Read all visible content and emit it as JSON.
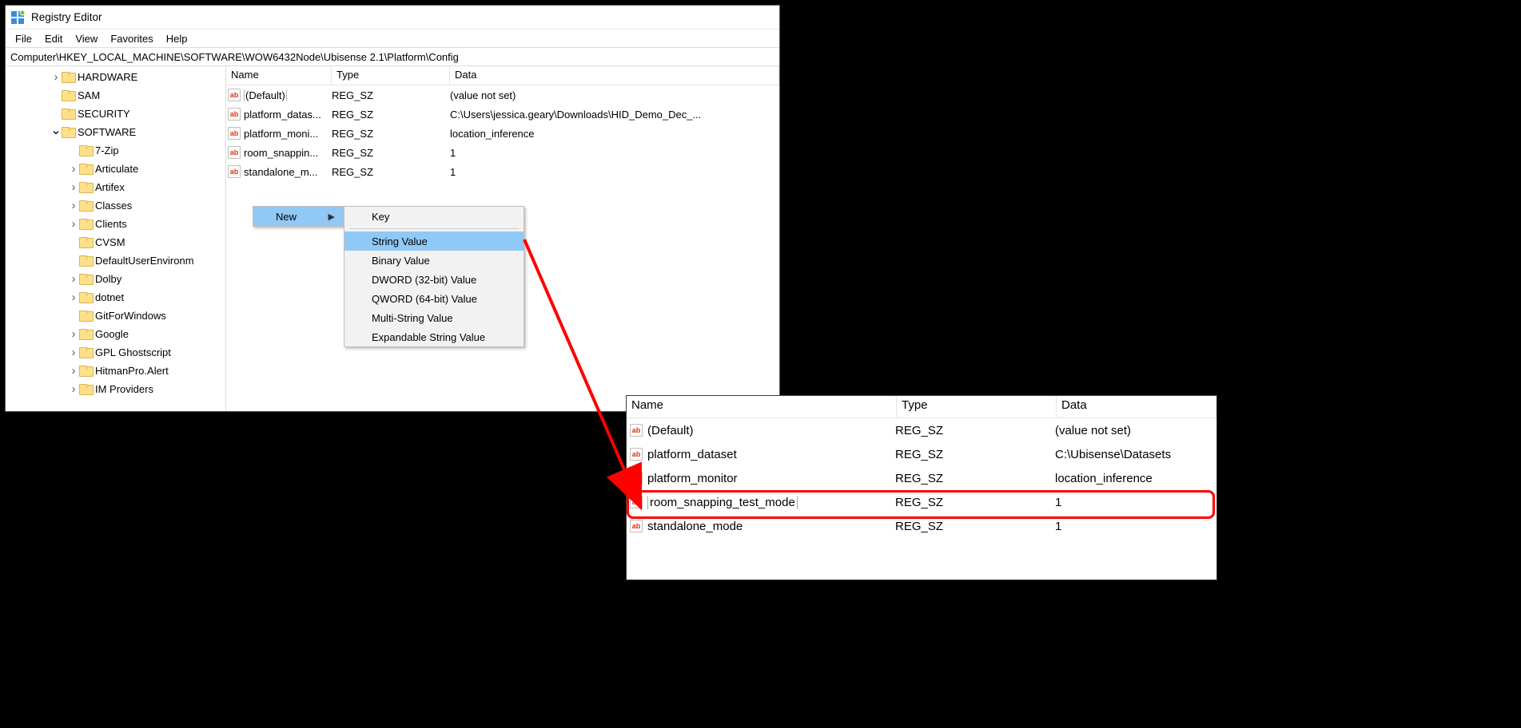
{
  "window": {
    "title": "Registry Editor",
    "menu": [
      "File",
      "Edit",
      "View",
      "Favorites",
      "Help"
    ],
    "address": "Computer\\HKEY_LOCAL_MACHINE\\SOFTWARE\\WOW6432Node\\Ubisense 2.1\\Platform\\Config"
  },
  "tree": [
    {
      "indent": 56,
      "twisty": ">",
      "label": "HARDWARE"
    },
    {
      "indent": 56,
      "twisty": "",
      "label": "SAM"
    },
    {
      "indent": 56,
      "twisty": "",
      "label": "SECURITY"
    },
    {
      "indent": 56,
      "twisty": "v",
      "label": "SOFTWARE"
    },
    {
      "indent": 78,
      "twisty": "",
      "label": "7-Zip"
    },
    {
      "indent": 78,
      "twisty": ">",
      "label": "Articulate"
    },
    {
      "indent": 78,
      "twisty": ">",
      "label": "Artifex"
    },
    {
      "indent": 78,
      "twisty": ">",
      "label": "Classes"
    },
    {
      "indent": 78,
      "twisty": ">",
      "label": "Clients"
    },
    {
      "indent": 78,
      "twisty": "",
      "label": "CVSM"
    },
    {
      "indent": 78,
      "twisty": "",
      "label": "DefaultUserEnvironm"
    },
    {
      "indent": 78,
      "twisty": ">",
      "label": "Dolby"
    },
    {
      "indent": 78,
      "twisty": ">",
      "label": "dotnet"
    },
    {
      "indent": 78,
      "twisty": "",
      "label": "GitForWindows"
    },
    {
      "indent": 78,
      "twisty": ">",
      "label": "Google"
    },
    {
      "indent": 78,
      "twisty": ">",
      "label": "GPL Ghostscript"
    },
    {
      "indent": 78,
      "twisty": ">",
      "label": "HitmanPro.Alert"
    },
    {
      "indent": 78,
      "twisty": ">",
      "label": "IM Providers"
    }
  ],
  "listHeaders": {
    "name": "Name",
    "type": "Type",
    "data": "Data"
  },
  "listRows": [
    {
      "name": "(Default)",
      "type": "REG_SZ",
      "data": "(value not set)",
      "focus": true
    },
    {
      "name": "platform_datas...",
      "type": "REG_SZ",
      "data": "C:\\Users\\jessica.geary\\Downloads\\HID_Demo_Dec_..."
    },
    {
      "name": "platform_moni...",
      "type": "REG_SZ",
      "data": "location_inference"
    },
    {
      "name": "room_snappin...",
      "type": "REG_SZ",
      "data": "1"
    },
    {
      "name": "standalone_m...",
      "type": "REG_SZ",
      "data": "1"
    }
  ],
  "ctx1": {
    "label": "New"
  },
  "ctx2": [
    {
      "label": "Key",
      "hl": false
    },
    {
      "sep": true
    },
    {
      "label": "String Value",
      "hl": true
    },
    {
      "label": "Binary Value"
    },
    {
      "label": "DWORD (32-bit) Value"
    },
    {
      "label": "QWORD (64-bit) Value"
    },
    {
      "label": "Multi-String Value"
    },
    {
      "label": "Expandable String Value"
    }
  ],
  "panel2Rows": [
    {
      "name": "(Default)",
      "type": "REG_SZ",
      "data": "(value not set)"
    },
    {
      "name": "platform_dataset",
      "type": "REG_SZ",
      "data": "C:\\Ubisense\\Datasets"
    },
    {
      "name": "platform_monitor",
      "type": "REG_SZ",
      "data": "location_inference"
    },
    {
      "name": "room_snapping_test_mode",
      "type": "REG_SZ",
      "data": "1",
      "editing": true
    },
    {
      "name": "standalone_mode",
      "type": "REG_SZ",
      "data": "1"
    }
  ]
}
